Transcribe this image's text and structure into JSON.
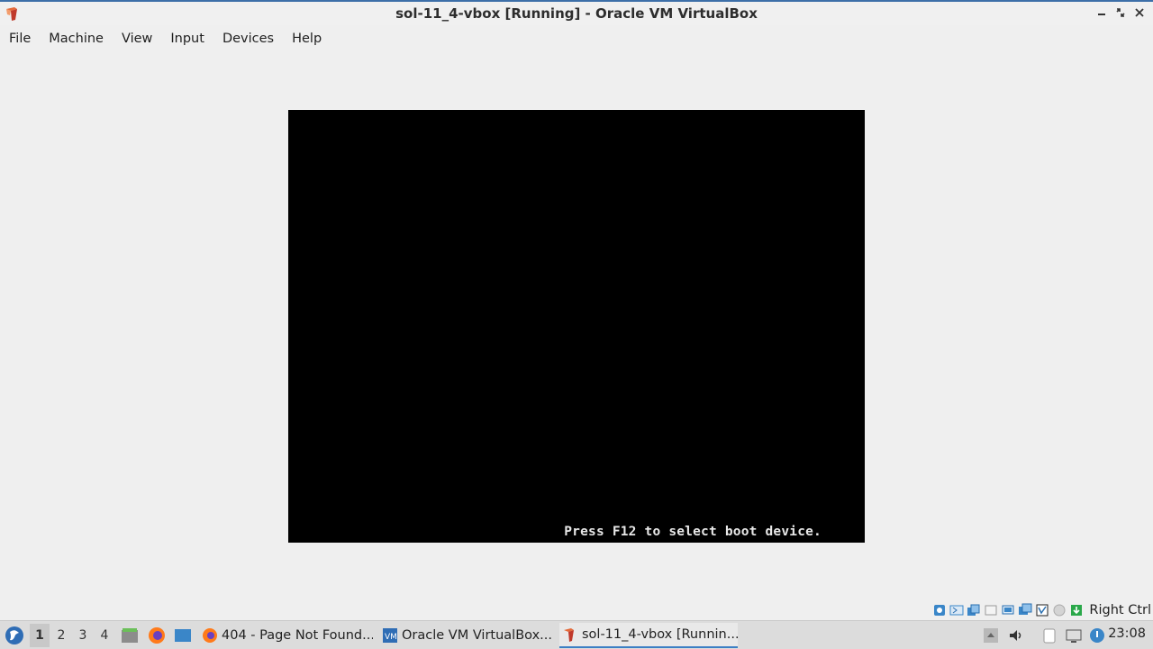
{
  "window": {
    "title": "sol-11_4-vbox [Running] - Oracle VM VirtualBox"
  },
  "menu": {
    "items": [
      "File",
      "Machine",
      "View",
      "Input",
      "Devices",
      "Help"
    ]
  },
  "vm": {
    "console_text": "Press F12 to select boot device."
  },
  "statusbar": {
    "icons": [
      "hard-disk-icon",
      "optical-drive-icon",
      "audio-icon",
      "network-icon",
      "usb-icon",
      "shared-folder-icon",
      "display-icon",
      "video-capture-icon",
      "cpu-icon",
      "mouse-integration-icon",
      "keyboard-icon"
    ],
    "host_key": "Right Ctrl"
  },
  "taskbar": {
    "desktops": [
      "1",
      "2",
      "3",
      "4"
    ],
    "active_desktop": "1",
    "tasks": [
      {
        "label": "404 - Page Not Found..."
      },
      {
        "label": "Oracle VM VirtualBox..."
      },
      {
        "label": "sol-11_4-vbox [Runnin..."
      }
    ],
    "clock": "23:08"
  },
  "colors": {
    "accent": "#3c7fc4",
    "vm_background": "#000000",
    "window_background": "#efefef"
  }
}
